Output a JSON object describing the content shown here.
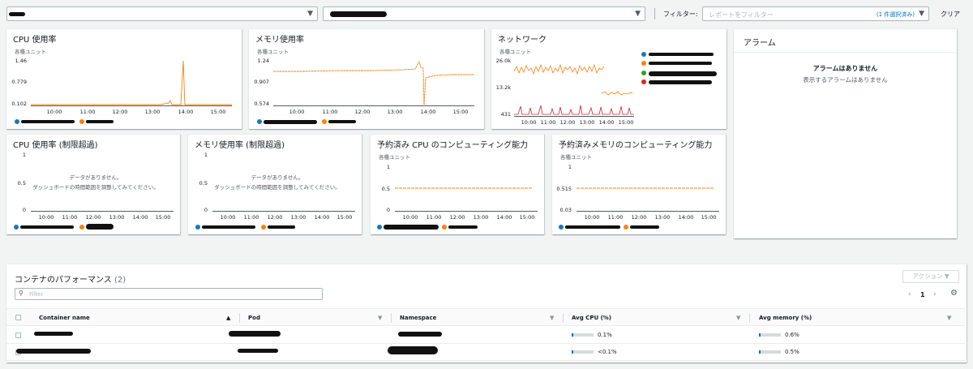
{
  "filter": {
    "label": "フィルター:",
    "placeholder": "レポートをフィルター",
    "count": "(1 件選択済み)",
    "clear": "クリア"
  },
  "charts": [
    {
      "title": "CPU 使用率",
      "unit": "各種ユニット",
      "y_ticks": [
        "1.46",
        "0.779",
        "0.102"
      ],
      "x_ticks": [
        "10:00",
        "11:00",
        "12:00",
        "13:00",
        "14:00",
        "15:00"
      ]
    },
    {
      "title": "メモリ使用率",
      "unit": "各種ユニット",
      "y_ticks": [
        "1.24",
        "0.907",
        "0.574"
      ],
      "x_ticks": [
        "10:00",
        "11:00",
        "12:00",
        "13:00",
        "14:00",
        "15:00"
      ]
    },
    {
      "title": "ネットワーク",
      "unit": "各種ユニット",
      "y_ticks": [
        "26.0k",
        "13.2k",
        "431"
      ],
      "x_ticks": [
        "10:00",
        "11:00",
        "12:00",
        "13:00",
        "14:00",
        "15:00"
      ]
    },
    {
      "title": "CPU 使用率 (制限超過)",
      "y_ticks": [
        "1",
        "0.5",
        "0"
      ],
      "x_ticks": [
        "10:00",
        "11:00",
        "12:00",
        "13:00",
        "14:00",
        "15:00"
      ],
      "no_data": "データがありません。",
      "no_data_hint": "ダッシュボードの時間範囲を調整してみてください。"
    },
    {
      "title": "メモリ使用率 (制限超過)",
      "y_ticks": [
        "1",
        "0.5",
        "0"
      ],
      "x_ticks": [
        "10:00",
        "11:00",
        "12:00",
        "13:00",
        "14:00",
        "15:00"
      ],
      "no_data": "データがありません。",
      "no_data_hint": "ダッシュボードの時間範囲を調整してみてください。"
    },
    {
      "title": "予約済み CPU のコンピューティング能力",
      "unit": "各種ユニット",
      "y_ticks": [
        "1",
        "0.5",
        "0"
      ],
      "x_ticks": [
        "10:00",
        "11:00",
        "12:00",
        "13:00",
        "14:00",
        "15:00"
      ]
    },
    {
      "title": "予約済みメモリのコンピューティング能力",
      "unit": "各種ユニット",
      "y_ticks": [
        "1",
        "0.515",
        "0.03"
      ],
      "x_ticks": [
        "10:00",
        "11:00",
        "12:00",
        "13:00",
        "14:00",
        "15:00"
      ]
    }
  ],
  "alarms": {
    "title": "アラーム",
    "none": "アラームはありません",
    "none_detail": "表示するアラームはありません"
  },
  "table": {
    "title": "コンテナのパフォーマンス",
    "count": "(2)",
    "actions": "アクション ▼",
    "filter_placeholder": "Filter",
    "page": "1",
    "columns": [
      "Container name",
      "Pod",
      "Namespace",
      "Avg CPU (%)",
      "Avg memory (%)"
    ],
    "rows": [
      {
        "cpu": "0.1%",
        "cpu_fill": 0.05,
        "mem": "0.6%",
        "mem_fill": 0.06
      },
      {
        "cpu": "<0.1%",
        "cpu_fill": 0.05,
        "mem": "0.5%",
        "mem_fill": 0.05
      }
    ]
  },
  "colors": {
    "blue": "#1f77b4",
    "orange": "#ff7f0e",
    "green": "#2ca02c",
    "red": "#d62728",
    "link": "#0073bb"
  }
}
